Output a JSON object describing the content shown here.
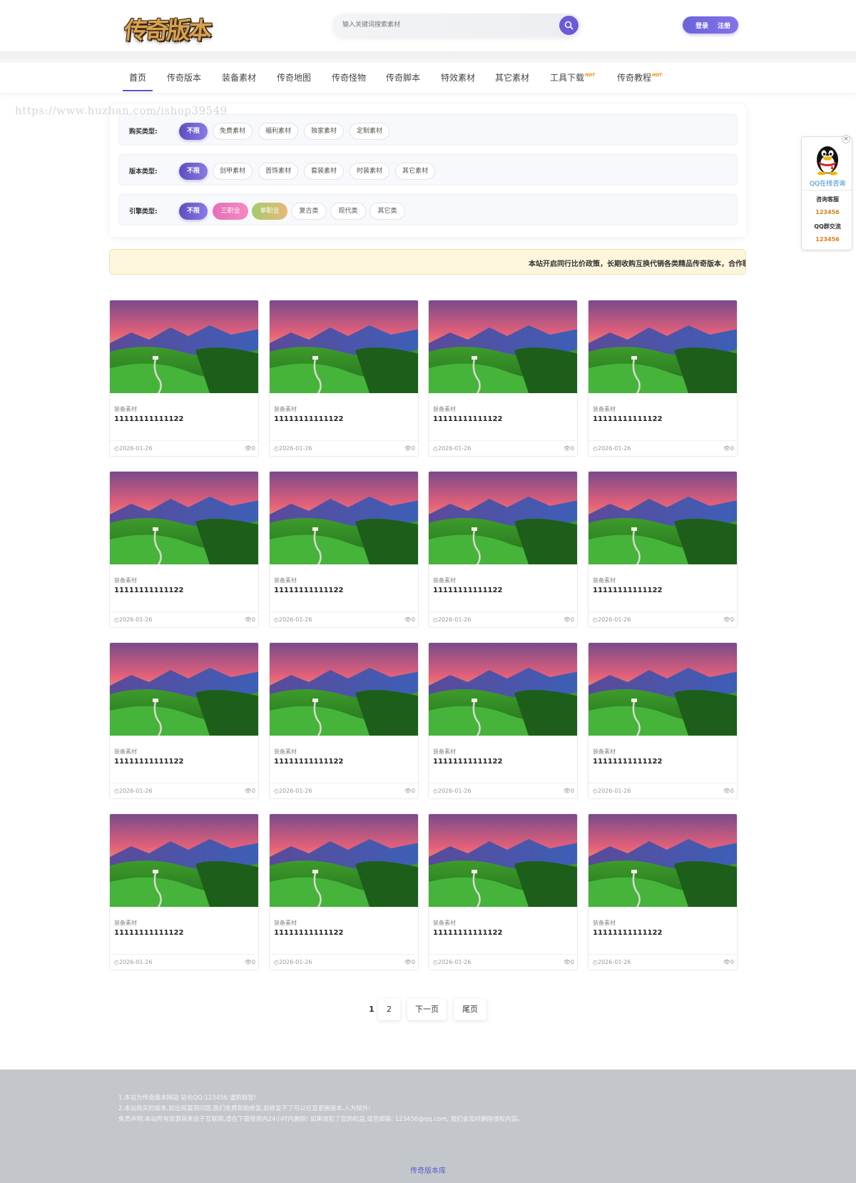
{
  "header": {
    "logo_text": "传奇版本库",
    "search_placeholder": "输入关键词搜索素材",
    "login_label": "登录",
    "register_label": "注册"
  },
  "nav": {
    "items": [
      {
        "label": "首页",
        "hot": false
      },
      {
        "label": "传奇版本",
        "hot": false
      },
      {
        "label": "装备素材",
        "hot": false
      },
      {
        "label": "传奇地图",
        "hot": false
      },
      {
        "label": "传奇怪物",
        "hot": false
      },
      {
        "label": "传奇脚本",
        "hot": false
      },
      {
        "label": "特效素材",
        "hot": false
      },
      {
        "label": "其它素材",
        "hot": false
      },
      {
        "label": "工具下载",
        "hot": true
      },
      {
        "label": "传奇教程",
        "hot": true
      }
    ],
    "hot_badge": "HOT",
    "active_index": 0
  },
  "watermark": "https://www.huzhan.com/ishop39549",
  "filters": [
    {
      "label": "购买类型:",
      "options": [
        "不限",
        "免费素材",
        "福利素材",
        "独家素材",
        "定制素材"
      ],
      "selected": 0
    },
    {
      "label": "版本类型:",
      "options": [
        "不限",
        "剑甲素材",
        "首饰素材",
        "套装素材",
        "时装素材",
        "其它素材"
      ],
      "selected": 0
    },
    {
      "label": "引擎类型:",
      "options": [
        "不限",
        "三职业",
        "单职业",
        "复古类",
        "现代类",
        "其它类"
      ],
      "selected": 0
    }
  ],
  "notice": "本站开启同行比价政策，长期收购互换代销各类精品传奇版本，合作联运",
  "cards": [
    {
      "category": "装备素材",
      "title": "11111111111122",
      "date": "2026-01-26",
      "views": "0"
    },
    {
      "category": "装备素材",
      "title": "11111111111122",
      "date": "2026-01-26",
      "views": "0"
    },
    {
      "category": "装备素材",
      "title": "11111111111122",
      "date": "2026-01-26",
      "views": "0"
    },
    {
      "category": "装备素材",
      "title": "11111111111122",
      "date": "2026-01-26",
      "views": "0"
    },
    {
      "category": "装备素材",
      "title": "11111111111122",
      "date": "2026-01-26",
      "views": "0"
    },
    {
      "category": "装备素材",
      "title": "11111111111122",
      "date": "2026-01-26",
      "views": "0"
    },
    {
      "category": "装备素材",
      "title": "11111111111122",
      "date": "2026-01-26",
      "views": "0"
    },
    {
      "category": "装备素材",
      "title": "11111111111122",
      "date": "2026-01-26",
      "views": "0"
    },
    {
      "category": "装备素材",
      "title": "11111111111122",
      "date": "2026-01-26",
      "views": "0"
    },
    {
      "category": "装备素材",
      "title": "11111111111122",
      "date": "2026-01-26",
      "views": "0"
    },
    {
      "category": "装备素材",
      "title": "11111111111122",
      "date": "2026-01-26",
      "views": "0"
    },
    {
      "category": "装备素材",
      "title": "11111111111122",
      "date": "2026-01-26",
      "views": "0"
    },
    {
      "category": "装备素材",
      "title": "11111111111122",
      "date": "2026-01-26",
      "views": "0"
    },
    {
      "category": "装备素材",
      "title": "11111111111122",
      "date": "2026-01-26",
      "views": "0"
    },
    {
      "category": "装备素材",
      "title": "11111111111122",
      "date": "2026-01-26",
      "views": "0"
    },
    {
      "category": "装备素材",
      "title": "11111111111122",
      "date": "2026-01-26",
      "views": "0"
    }
  ],
  "pagination": {
    "current": "1",
    "page2": "2",
    "next_label": "下一页",
    "last_label": "尾页"
  },
  "footer": {
    "line1": "1.本站为传奇版本网站 站长QQ:123456 谨防假冒!",
    "line2": "2.本站购买的版本,如出现漏洞问题,我们免费帮助修复,如修复不了可以任意更换版本,人为除外!",
    "line3": "免责声明:本站所有资源皆来自于互联网,请在下载使用内24小时内删除!  如果侵犯了您的权益,请至邮箱: 123456@qq.com, 我们会及时删除侵权内容。",
    "brand": "传奇版本库"
  },
  "qq_float": {
    "close_glyph": "×",
    "consult_label": "QQ在线咨询",
    "service_heading": "咨询客服",
    "service_number": "123456",
    "group_heading": "QQ群交流",
    "group_number": "123456"
  },
  "colors": {
    "accent": "#6b5bd6",
    "hot": "#f08a00",
    "notice_bg": "#fdf6dc",
    "footer_bg": "#c3c6cb",
    "qq_number": "#e07a1d"
  },
  "icons": {
    "search": "search-icon",
    "clock": "clock-icon",
    "eye": "eye-icon",
    "qq": "qq-penguin-icon",
    "close": "close-icon"
  }
}
